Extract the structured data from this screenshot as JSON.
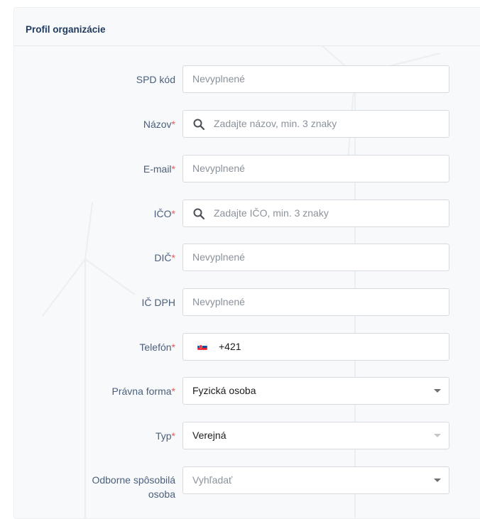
{
  "card": {
    "title": "Profil organizácie"
  },
  "fields": {
    "spd": {
      "label": "SPD kód",
      "placeholder": "Nevyplnené"
    },
    "nazov": {
      "label": "Názov",
      "required": "*",
      "placeholder": "Zadajte názov, min. 3 znaky",
      "icon": "search-icon"
    },
    "email": {
      "label": "E-mail",
      "required": "*",
      "placeholder": "Nevyplnené"
    },
    "ico": {
      "label": "IČO",
      "required": "*",
      "placeholder": "Zadajte IČO, min. 3 znaky",
      "icon": "search-icon"
    },
    "dic": {
      "label": "DIČ",
      "required": "*",
      "placeholder": "Nevyplnené"
    },
    "icdph": {
      "label": "IČ DPH",
      "placeholder": "Nevyplnené"
    },
    "telefon": {
      "label": "Telefón",
      "required": "*",
      "prefix": "+421",
      "flag": "slovakia-flag-icon"
    },
    "pravna_forma": {
      "label": "Právna forma",
      "required": "*",
      "value": "Fyzická osoba"
    },
    "typ": {
      "label": "Typ",
      "required": "*",
      "value": "Verejná"
    },
    "odborne": {
      "label_line1": "Odborne spôsobilá",
      "label_line2": "osoba",
      "placeholder": "Vyhľadať"
    }
  },
  "colors": {
    "label": "#4a5f7c",
    "required": "#e35d5d",
    "title": "#1f3a5f",
    "placeholder": "#8a929b",
    "border": "#d7dbe0"
  }
}
